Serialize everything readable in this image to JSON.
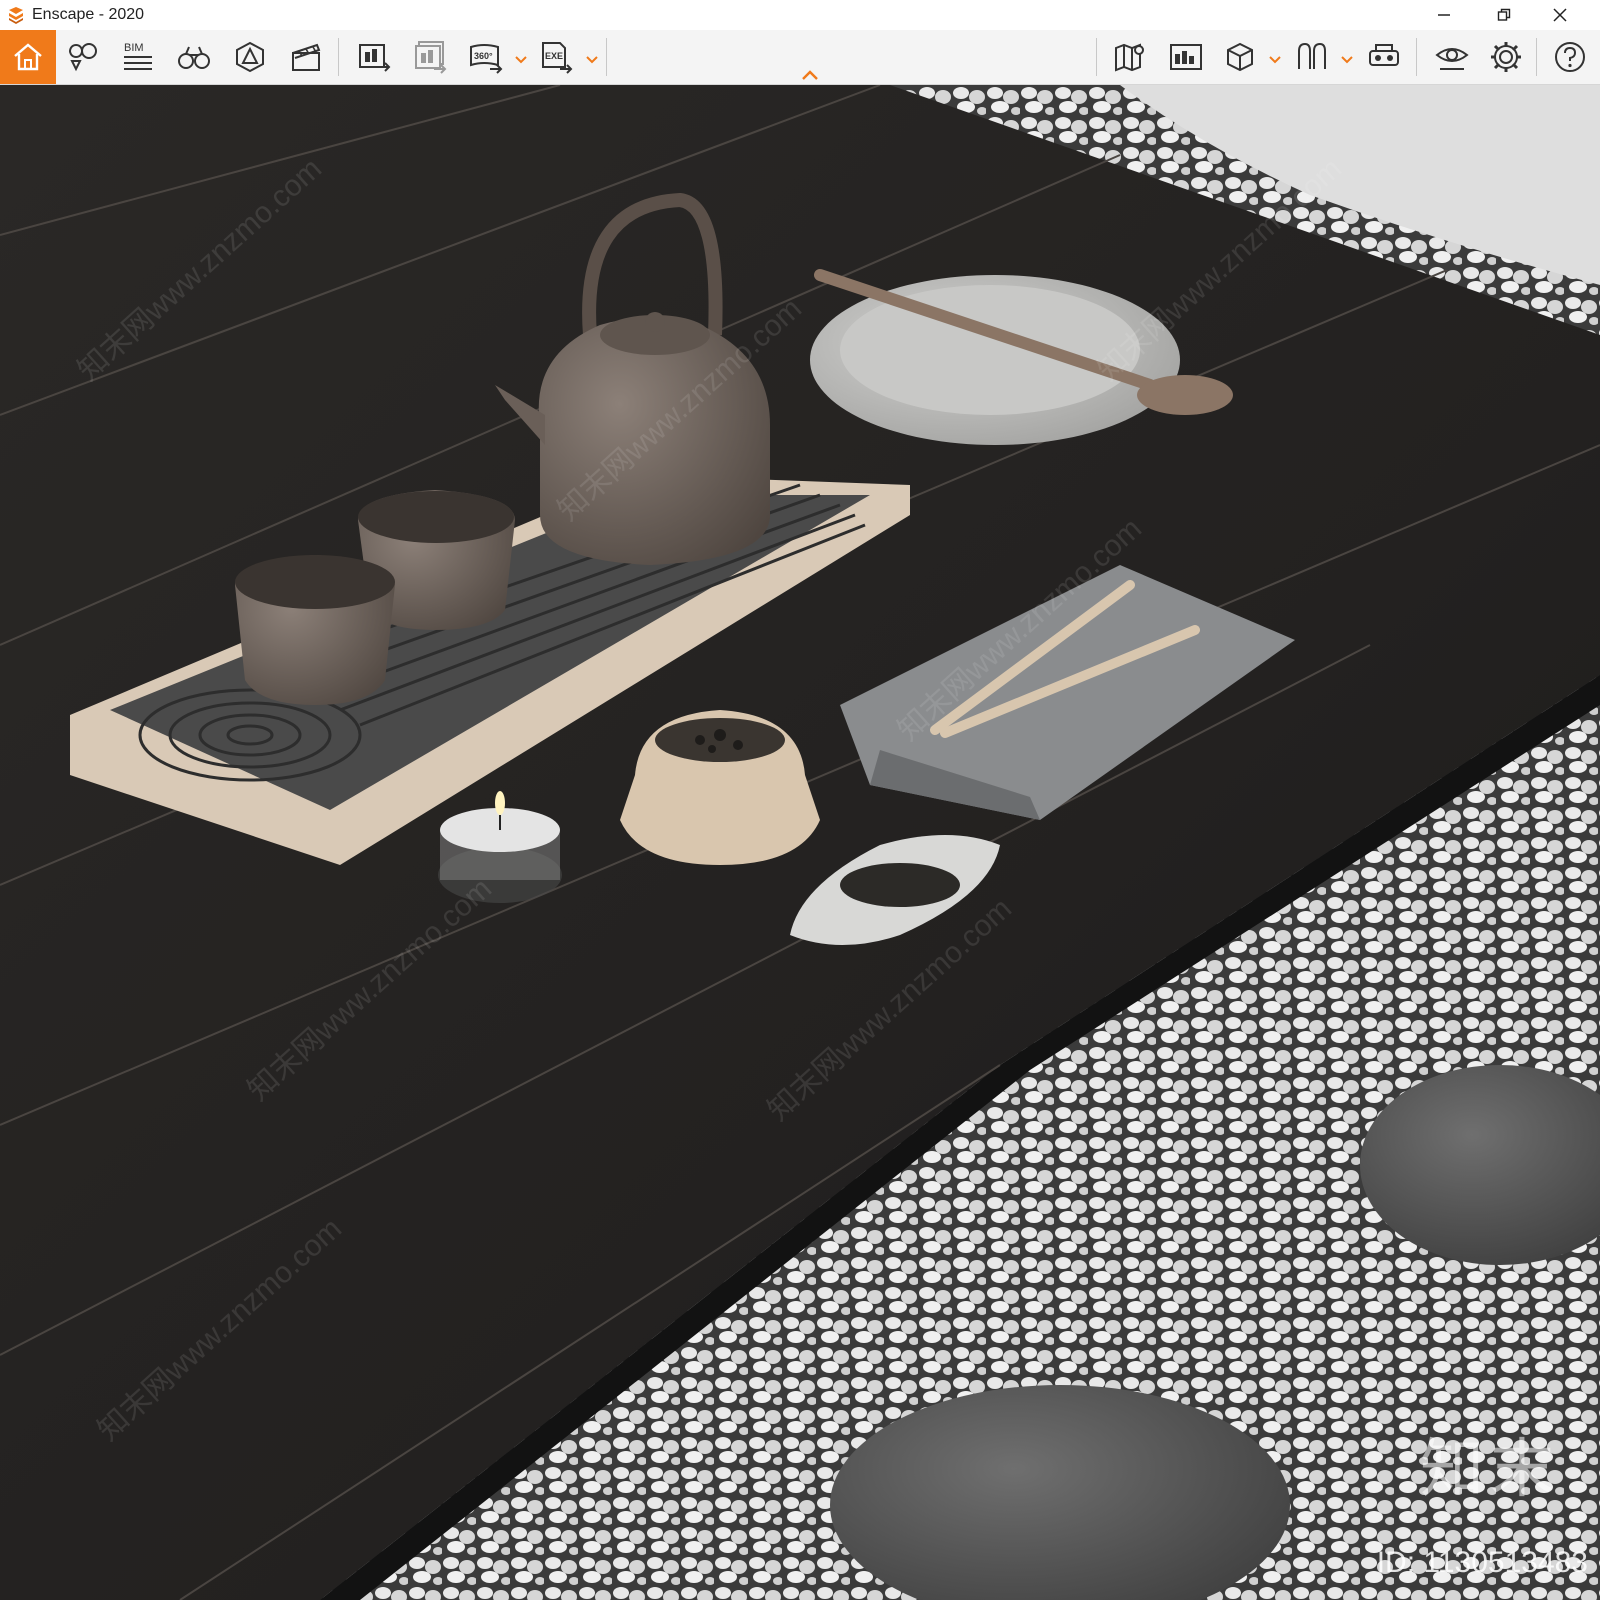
{
  "window": {
    "title": "Enscape - 2020",
    "controls": [
      "minimize-icon",
      "restore-icon",
      "close-icon"
    ]
  },
  "toolbar": {
    "accent_color": "#f07a1a",
    "bim_label": "BIM",
    "pano_label": "360°",
    "exe_label": "EXE",
    "left_icons": [
      "home-icon",
      "view-management-icon",
      "bim-icon",
      "binoculars-icon",
      "asset-library-icon",
      "video-editor-icon"
    ],
    "export_icons": [
      "render-image-icon",
      "batch-render-icon",
      "panorama-360-icon",
      "exe-standalone-icon"
    ],
    "right_icons": [
      "map-icon",
      "render-export-icon",
      "cube-icon",
      "vr-icon",
      "vr-headset-icon",
      "visual-settings-icon",
      "settings-icon",
      "help-icon"
    ]
  },
  "watermark": {
    "text": "知末网www.znzmo.com",
    "brand": "知末",
    "image_id": "ID: 1130513483"
  }
}
